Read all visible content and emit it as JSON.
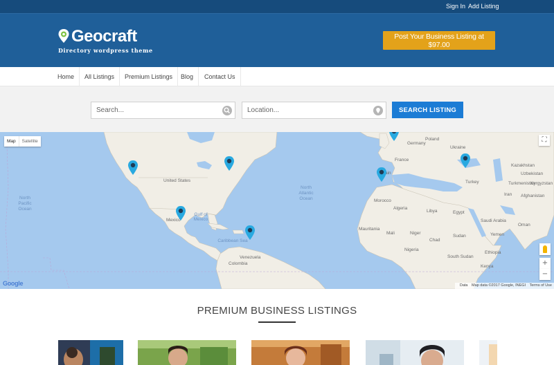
{
  "topbar": {
    "sign_in": "Sign In",
    "add_listing": "Add Listing"
  },
  "brand": {
    "name": "Geocraft",
    "tagline": "Directory wordpress theme",
    "logo_icon": "map-pin-icon"
  },
  "header": {
    "cta_label": "Post Your Business Listing at $97.00"
  },
  "nav": {
    "items": [
      {
        "label": "Home"
      },
      {
        "label": "All Listings"
      },
      {
        "label": "Premium Listings"
      },
      {
        "label": "Blog"
      },
      {
        "label": "Contact Us"
      }
    ]
  },
  "search": {
    "keyword_placeholder": "Search...",
    "location_placeholder": "Location...",
    "button_label": "SEARCH LISTING",
    "keyword_icon": "magnifier-icon",
    "location_icon": "location-pin-icon"
  },
  "map": {
    "type_buttons": [
      "Map",
      "Satellite"
    ],
    "zoom_in": "+",
    "zoom_out": "−",
    "fullscreen_icon": "fullscreen-icon",
    "streetview_icon": "pegman-icon",
    "provider_logo": "Google",
    "attribution": [
      "Data",
      "Map data ©2017 Google, INEGI",
      "Terms of Use"
    ],
    "labels": {
      "united_states": "United States",
      "mexico": "Mexico",
      "north_pacific": "North",
      "north_pacific_2": "Pacific",
      "north_pacific_3": "Ocean",
      "north_atlantic": "North",
      "north_atlantic_2": "Atlantic",
      "north_atlantic_3": "Ocean",
      "gulf": "Gulf of",
      "gulf_2": "Mexico",
      "caribbean": "Caribbean Sea",
      "venezuela": "Venezuela",
      "colombia": "Colombia",
      "france": "France",
      "spain": "Spain",
      "turkey": "Turkey",
      "morocco": "Morocco",
      "algeria": "Algeria",
      "libya": "Libya",
      "egypt": "Egypt",
      "mali": "Mali",
      "niger": "Niger",
      "chad": "Chad",
      "sudan": "Sudan",
      "mauritania": "Mauritania",
      "nigeria": "Nigeria",
      "south_sudan": "South Sudan",
      "saudi": "Saudi Arabia",
      "iran": "Iran",
      "kazakhstan": "Kazakhstan",
      "uzbekistan": "Uzbekistan",
      "turkmenistan": "Turkmenistan",
      "afghanistan": "Afghanistan",
      "ukraine": "Ukraine",
      "poland": "Poland",
      "germany": "Germany",
      "kenya": "Kenya",
      "ethiopia": "Ethiopia",
      "yemen": "Yemen",
      "oman": "Oman",
      "kyrgyz": "Kyrgyzstan"
    },
    "marker_color": "#29a9e0"
  },
  "premium": {
    "title": "PREMIUM BUSINESS LISTINGS"
  },
  "colors": {
    "topbar": "#164b7c",
    "header": "#1f5f99",
    "cta": "#e3a21a",
    "search_button": "#1c7cd5",
    "water": "#a5c9ee",
    "land": "#f1eee6"
  }
}
